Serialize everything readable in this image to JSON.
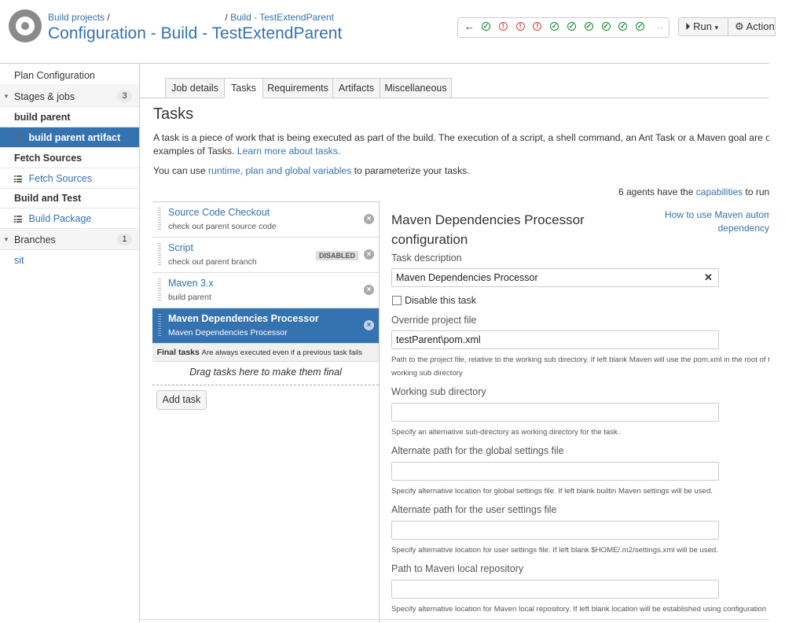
{
  "header": {
    "breadcrumb": {
      "root": "Build projects",
      "sep1": "/",
      "sep2": "/",
      "plan": "Build - TestExtendParent"
    },
    "title": "Configuration - Build - TestExtendParent",
    "history": {
      "prev": "←",
      "next": "→",
      "statuses": [
        "ok",
        "fail",
        "fail",
        "fail",
        "ok",
        "ok",
        "ok",
        "ok",
        "ok",
        "ok"
      ]
    },
    "run_label": "Run",
    "actions_label": "Actions"
  },
  "sidebar": {
    "plan_configuration": "Plan Configuration",
    "stages_jobs": {
      "label": "Stages & jobs",
      "count": "3"
    },
    "stage1": "build parent",
    "job1": "build parent artifact",
    "stage2": "Fetch Sources",
    "job2": "Fetch Sources",
    "stage3": "Build and Test",
    "job3": "Build Package",
    "branches": {
      "label": "Branches",
      "count": "1"
    },
    "branch1": "sit"
  },
  "tabs": [
    "Job details",
    "Tasks",
    "Requirements",
    "Artifacts",
    "Miscellaneous"
  ],
  "main": {
    "heading": "Tasks",
    "intro_1": "A task is a piece of work that is being executed as part of the build. The execution of a script, a shell command, an Ant Task or a Maven goal are only few",
    "intro_2a": "examples of Tasks.",
    "intro_2_link": "Learn more about tasks",
    "intro_2b": ".",
    "vars_a": "You can use",
    "vars_link": "runtime, plan and global variables",
    "vars_b": "to parameterize your tasks.",
    "agents_a": "6 agents have the",
    "agents_link": "capabilities",
    "agents_b": "to run this job"
  },
  "tasks": [
    {
      "name": "Source Code Checkout",
      "desc": "check out parent source code"
    },
    {
      "name": "Script",
      "desc": "check out parent branch",
      "badge": "DISABLED"
    },
    {
      "name": "Maven 3.x",
      "desc": "build parent"
    },
    {
      "name": "Maven Dependencies Processor",
      "desc": "Maven Dependencies Processor"
    }
  ],
  "final_tasks": {
    "label": "Final tasks",
    "note": "Are always executed even if a previous task fails",
    "drop": "Drag tasks here to make them final"
  },
  "add_task": "Add task",
  "config": {
    "title_1": "Maven Dependencies Processor",
    "title_2": "configuration",
    "help_1": "How to use Maven automatic",
    "help_2": "dependency",
    "task_description_label": "Task description",
    "task_description_value": "Maven Dependencies Processor",
    "disable_label": "Disable this task",
    "override_label": "Override project file",
    "override_value": "testParent\\pom.xml",
    "override_hint_1": "Path to the project file, relative to the working sub directory. If left blank Maven will use the pom.xml in the root of the",
    "override_hint_2": "working sub directory",
    "working_label": "Working sub directory",
    "working_value": "",
    "working_hint": "Specify an alternative sub-directory as working directory for the task.",
    "global_label": "Alternate path for the global settings file",
    "global_value": "",
    "global_hint": "Specify alternative location for global settings file. If left blank builtin Maven settings will be used.",
    "user_label": "Alternate path for the user settings file",
    "user_value": "",
    "user_hint": "Specify alternative location for user settings file. If left blank $HOME/.m2/settings.xml will be used.",
    "repo_label": "Path to Maven local repository",
    "repo_value": "",
    "repo_hint": "Specify alternative location for Maven local repository. If left blank location will be established using configuration"
  },
  "colors": {
    "link": "#3572b0",
    "ok": "#14892c",
    "fail": "#d04437"
  }
}
